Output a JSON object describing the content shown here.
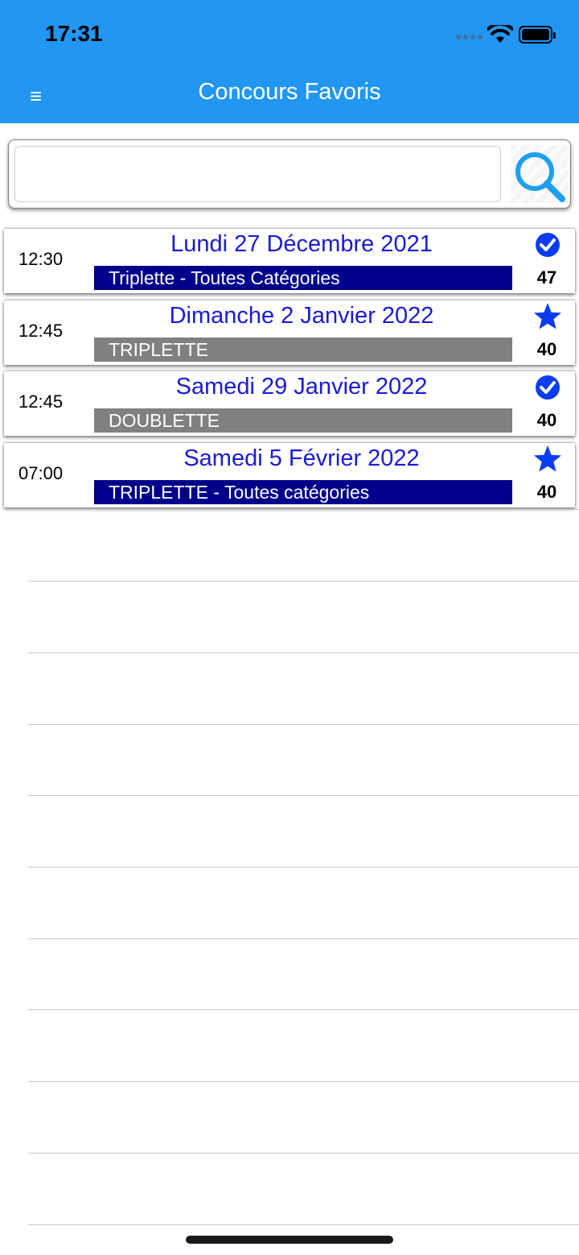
{
  "status_bar": {
    "time": "17:31"
  },
  "header": {
    "title": "Concours Favoris",
    "menu_icon": "menu-icon"
  },
  "search": {
    "value": "",
    "placeholder": "",
    "icon": "search-icon"
  },
  "colors": {
    "header_bg": "#2196F3",
    "date_text": "#1a1ad6",
    "category_navy": "#00008B",
    "category_gray": "#808080",
    "icon_blue": "#0A3CF0"
  },
  "favorites": [
    {
      "time": "12:30",
      "date": "Lundi 27 Décembre 2021",
      "category": "Triplette - Toutes Catégories",
      "category_style": "navy",
      "status_icon": "check-circle-icon",
      "count": "47"
    },
    {
      "time": "12:45",
      "date": "Dimanche 2 Janvier 2022",
      "category": "TRIPLETTE",
      "category_style": "gray",
      "status_icon": "star-icon",
      "count": "40"
    },
    {
      "time": "12:45",
      "date": "Samedi 29 Janvier 2022",
      "category": "DOUBLETTE",
      "category_style": "gray",
      "status_icon": "check-circle-icon",
      "count": "40"
    },
    {
      "time": "07:00",
      "date": "Samedi 5 Février 2022",
      "category": "TRIPLETTE - Toutes catégories",
      "category_style": "navy",
      "status_icon": "star-icon",
      "count": "40"
    }
  ]
}
